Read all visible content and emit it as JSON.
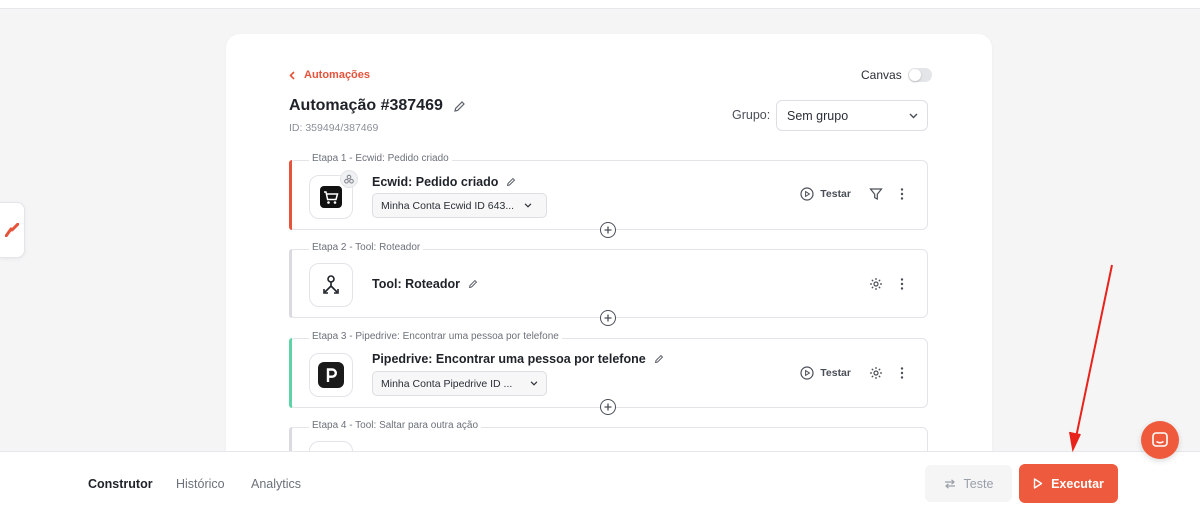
{
  "header": {
    "back_label": "Automações",
    "canvas_label": "Canvas",
    "title": "Automação #387469",
    "id_text": "ID: 359494/387469",
    "group_label": "Grupo:",
    "group_value": "Sem grupo"
  },
  "steps": [
    {
      "label": "Etapa 1 - Ecwid: Pedido criado",
      "name": "Ecwid: Pedido criado",
      "account": "Minha Conta Ecwid ID 643...",
      "test_label": "Testar",
      "accent": "#e5533b"
    },
    {
      "label": "Etapa 2 - Tool: Roteador",
      "name": "Tool: Roteador"
    },
    {
      "label": "Etapa 3 - Pipedrive: Encontrar uma pessoa por telefone",
      "name": "Pipedrive: Encontrar uma pessoa por telefone",
      "account": "Minha Conta Pipedrive ID ...",
      "test_label": "Testar",
      "accent": "#5ed3a8"
    },
    {
      "label": "Etapa 4 - Tool: Saltar para outra ação"
    }
  ],
  "footer": {
    "tabs": [
      "Construtor",
      "Histórico",
      "Analytics"
    ],
    "test_label": "Teste",
    "run_label": "Executar"
  },
  "colors": {
    "brand": "#ee5a3d",
    "annotation_arrow": "#e8231b"
  }
}
